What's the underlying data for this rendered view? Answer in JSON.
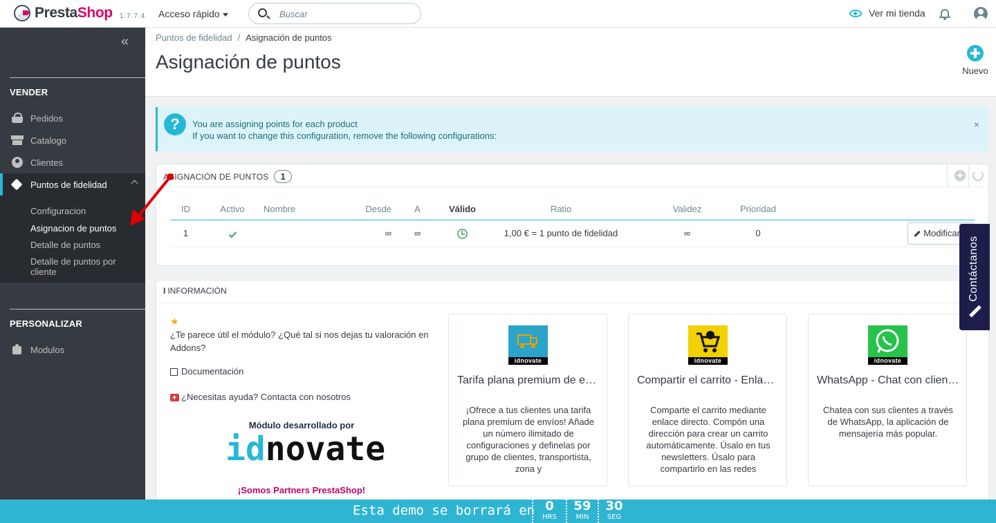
{
  "header": {
    "logo_left": "Presta",
    "logo_right": "Shop",
    "version": "1.7.7.4",
    "quick_access": "Acceso rápido",
    "search_placeholder": "Buscar",
    "view_store": "Ver mi tienda"
  },
  "sidebar": {
    "sections": [
      {
        "title": "VENDER"
      },
      {
        "title": "PERSONALIZAR"
      }
    ],
    "items": [
      {
        "label": "Pedidos",
        "icon": "basket-icon"
      },
      {
        "label": "Catalogo",
        "icon": "store-icon"
      },
      {
        "label": "Clientes",
        "icon": "person-icon"
      },
      {
        "label": "Puntos de fidelidad",
        "icon": "tag-icon"
      },
      {
        "label": "Modulos",
        "icon": "puzzle-icon"
      }
    ],
    "submenu": [
      {
        "label": "Configuracion"
      },
      {
        "label": "Asignacion de puntos"
      },
      {
        "label": "Detalle de puntos"
      },
      {
        "label": "Detalle de puntos por cliente"
      }
    ]
  },
  "page": {
    "breadcrumb": [
      "Puntos de fidelidad",
      "Asignación de puntos"
    ],
    "breadcrumb_sep": "/",
    "title": "Asignación de puntos",
    "new_button": "Nuevo"
  },
  "alert": {
    "line1": "You are assigning points for each product",
    "line2": "If you want to change this configuration, remove the following configurations:",
    "close": "×",
    "icon_glyph": "?"
  },
  "list_panel": {
    "heading": "Asignación de puntos",
    "count": "1",
    "columns": [
      "ID",
      "Activo",
      "Nombre",
      "Desde",
      "A",
      "Válido",
      "Ratio",
      "Validez",
      "Prioridad"
    ],
    "rows": [
      {
        "id": "1",
        "nombre": "",
        "desde": "∞",
        "a": "∞",
        "ratio": "1,00 € = 1 punto de fidelidad",
        "validez": "∞",
        "prioridad": "0",
        "action": "Modificar"
      }
    ]
  },
  "info_panel": {
    "heading": "INFORMACIÓN",
    "info_glyph": "i",
    "star_glyph": "★",
    "rate_text": "¿Te parece útil el módulo? ¿Qué tal si nos dejas tu valoración en Addons?",
    "doc_link": "Documentación",
    "help_link": "¿Necesitas ayuda? Contacta con nosotros",
    "developed_by": "Módulo desarrollado por",
    "brand": "idnovate",
    "partners": "¡Somos Partners PrestaShop!",
    "cards": [
      {
        "title": "Tarifa plana premium de envíos",
        "desc": "¡Ofrece a tus clientes una tarifa plana premium de envíos! Añade un número ilimitado de configuraciones y definelas por grupo de clientes, transportista, zona y",
        "band": "idnovate",
        "color": "#2aa4c9"
      },
      {
        "title": "Compartir el carrito - Enlace directo",
        "desc": "Comparte el carrito mediante enlace directo. Compón una dirección para crear un carrito automáticamente. Úsalo en tus newsletters. Úsalo para compartirlo en las redes",
        "band": "idnovate",
        "color": "#f2d100"
      },
      {
        "title": "WhatsApp - Chat con clientes",
        "desc": "Chatea con sus clientes a través de WhatsApp, la aplicación de mensajería más popular.",
        "band": "idnovate",
        "color": "#25c34a"
      }
    ]
  },
  "contact_tab": "Contáctanos",
  "countdown": {
    "message": "Esta demo se borrará en",
    "hours": "0",
    "hours_label": "HRS",
    "minutes": "59",
    "minutes_label": "MIN",
    "seconds": "30",
    "seconds_label": "SEG"
  },
  "colors": {
    "accent": "#25b9d7",
    "brand": "#df0067",
    "sidebar": "#363a41",
    "countdown": "#2fb5d2",
    "contact": "#1e1e4b"
  }
}
